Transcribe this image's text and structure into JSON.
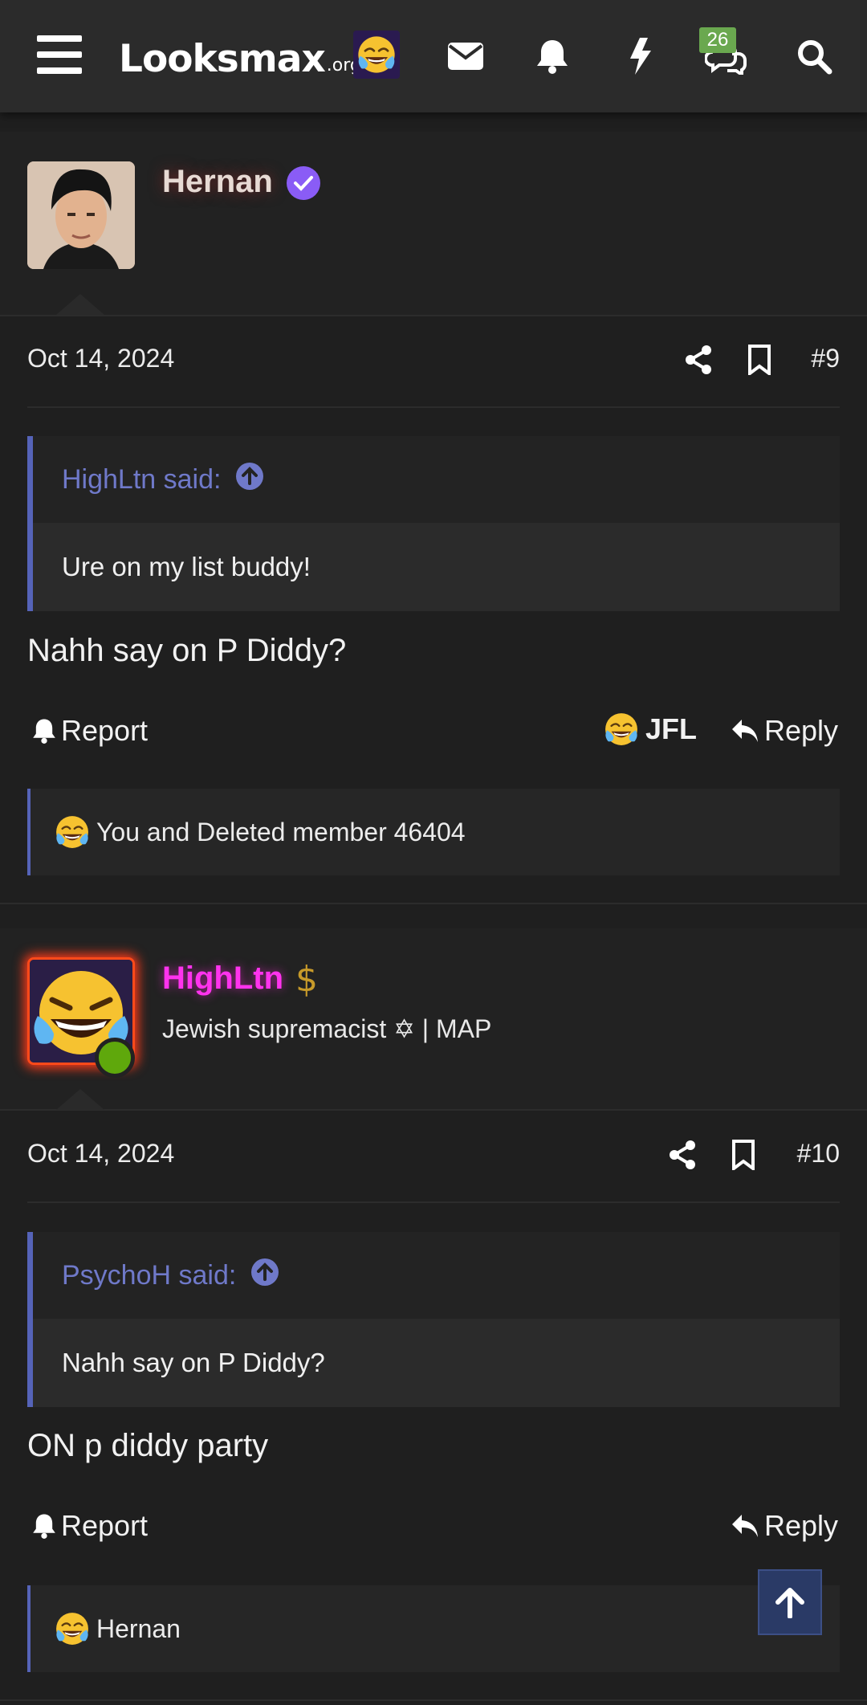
{
  "header": {
    "logo_main": "Looksmax",
    "logo_sub": ".org",
    "notification_count": "26",
    "icons": [
      "menu-icon",
      "mail-icon",
      "bell-icon",
      "lightning-icon",
      "chat-icon",
      "search-icon"
    ]
  },
  "posts": [
    {
      "author": "Hernan",
      "author_color": "#e7dad4",
      "verified": true,
      "date": "Oct 14, 2024",
      "number": "#9",
      "quote": {
        "author": "HighLtn said:",
        "text": "Ure on my list buddy!"
      },
      "body": "Nahh say on P Diddy?",
      "actions": {
        "report": "Report",
        "reaction": "JFL",
        "reply": "Reply"
      },
      "reactions_text": "You and Deleted member 46404"
    },
    {
      "author": "HighLtn",
      "author_color": "#ff33ee",
      "title": "Jewish supremacist ✡ | MAP",
      "online": true,
      "date": "Oct 14, 2024",
      "number": "#10",
      "quote": {
        "author": "PsychoH said:",
        "text": "Nahh say on P Diddy?"
      },
      "body": "ON p diddy party",
      "actions": {
        "report": "Report",
        "reply": "Reply"
      },
      "reactions_text": "Hernan"
    }
  ],
  "colors": {
    "accent": "#5563b8",
    "quote_link": "#6f79c9",
    "badge": "#6aa84f",
    "verified": "#8a5cf6",
    "online": "#5fa80c"
  }
}
